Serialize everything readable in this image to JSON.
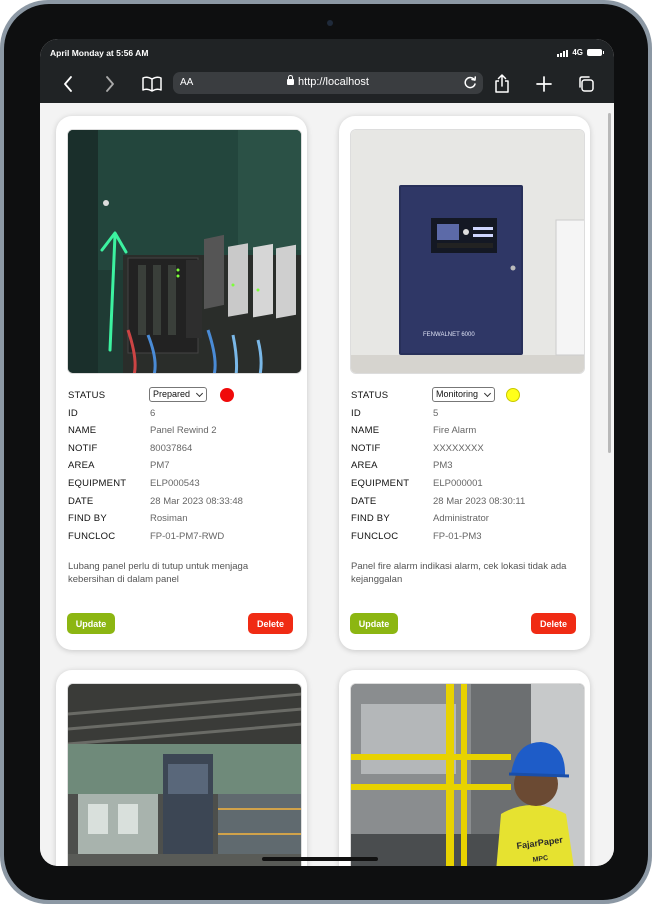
{
  "statusbar": {
    "time": "April Monday at 5:56 AM",
    "network": "4G"
  },
  "browser": {
    "aa_label": "AA",
    "url": "http://localhost"
  },
  "cards": [
    {
      "status": {
        "label": "STATUS",
        "value": "Prepared",
        "indicator_color": "#f00a0a"
      },
      "id": {
        "label": "ID",
        "value": "6"
      },
      "name": {
        "label": "NAME",
        "value": "Panel Rewind 2"
      },
      "notif": {
        "label": "NOTIF",
        "value": "80037864"
      },
      "area": {
        "label": "AREA",
        "value": "PM7"
      },
      "equipment": {
        "label": "EQUIPMENT",
        "value": "ELP000543"
      },
      "date": {
        "label": "DATE",
        "value": "28 Mar 2023 08:33:48"
      },
      "find_by": {
        "label": "FIND BY",
        "value": "Rosiman"
      },
      "funcloc": {
        "label": "FUNCLOC",
        "value": "FP-01-PM7-RWD"
      },
      "description": "Lubang panel perlu di tutup untuk menjaga kebersihan di dalam panel",
      "update_label": "Update",
      "delete_label": "Delete"
    },
    {
      "status": {
        "label": "STATUS",
        "value": "Monitoring",
        "indicator_color": "#ffff1a"
      },
      "id": {
        "label": "ID",
        "value": "5"
      },
      "name": {
        "label": "NAME",
        "value": "Fire Alarm"
      },
      "notif": {
        "label": "NOTIF",
        "value": "XXXXXXXX"
      },
      "area": {
        "label": "AREA",
        "value": "PM3"
      },
      "equipment": {
        "label": "EQUIPMENT",
        "value": "ELP000001"
      },
      "date": {
        "label": "DATE",
        "value": "28 Mar 2023 08:30:11"
      },
      "find_by": {
        "label": "FIND BY",
        "value": "Administrator"
      },
      "funcloc": {
        "label": "FUNCLOC",
        "value": "FP-01-PM3"
      },
      "description": "Panel fire alarm indikasi alarm, cek lokasi tidak ada kejanggalan",
      "update_label": "Update",
      "delete_label": "Delete"
    }
  ],
  "photo_text": {
    "panel_brand": "FENWALNET 6000",
    "shirt_brand": "FajarPaper",
    "shirt_sub": "MPC"
  },
  "colors": {
    "update": "#8cb612",
    "delete": "#f02b14",
    "chrome": "#202325"
  }
}
